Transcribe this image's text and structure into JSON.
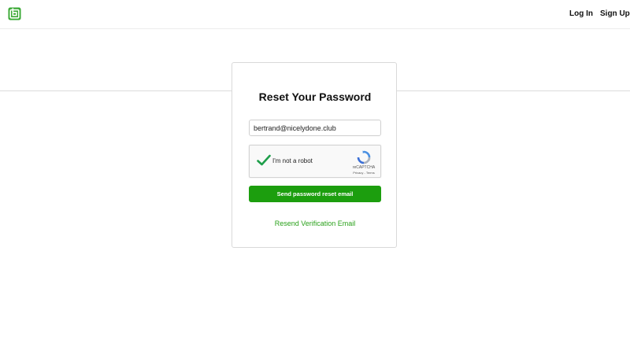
{
  "header": {
    "logo_icon": "brand-logo-icon",
    "brand_color": "#3aa935",
    "nav": {
      "login_label": "Log In",
      "signup_label": "Sign Up"
    }
  },
  "reset_card": {
    "title": "Reset Your Password",
    "email_value": "bertrand@nicelydone.club",
    "recaptcha": {
      "label": "I'm not a robot",
      "checked": true,
      "brand": "reCAPTCHA",
      "privacy_label": "Privacy",
      "separator": " - ",
      "terms_label": "Terms"
    },
    "submit_label": "Send password reset email",
    "resend_label": "Resend Verification Email",
    "accent_color": "#1c9e0e"
  }
}
